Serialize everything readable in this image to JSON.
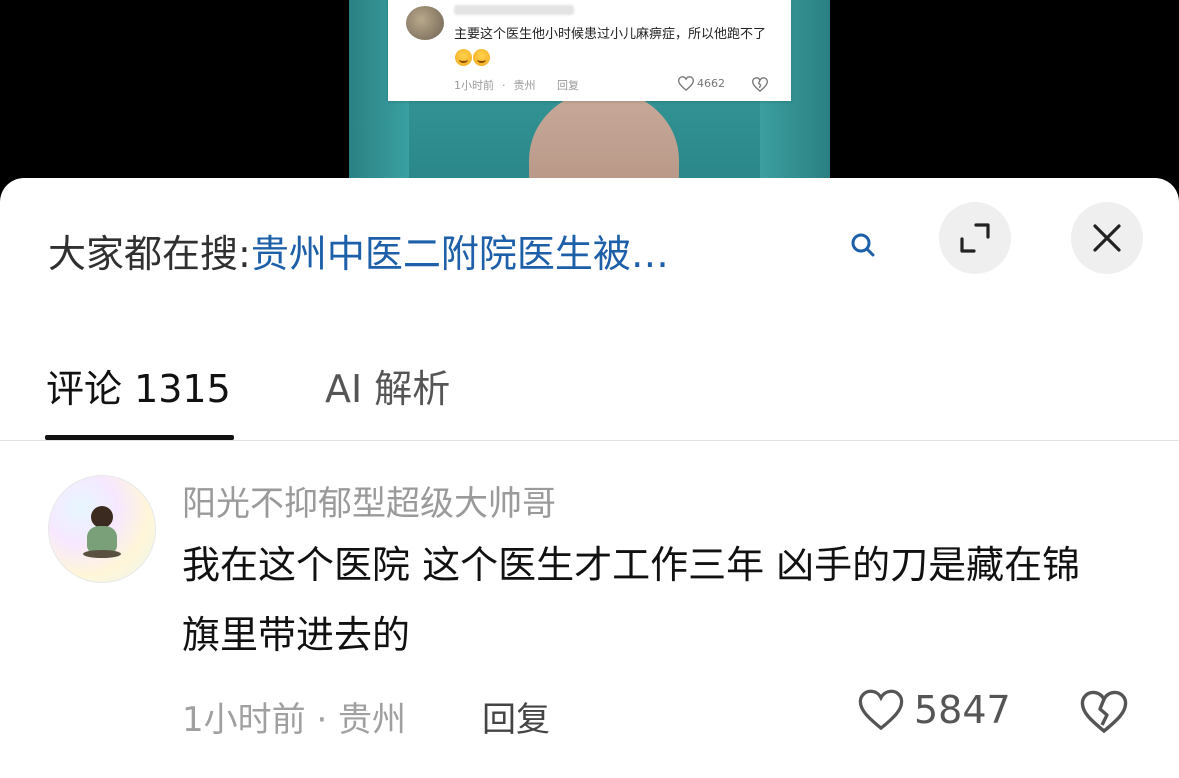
{
  "video_comment": {
    "text": "主要这个医生他小时候患过小儿麻痹症，所以他跑不了",
    "time": "1小时前",
    "location": "贵州",
    "reply_label": "回复",
    "likes": "4662"
  },
  "search_bar": {
    "prefix": "大家都在搜:",
    "query": "贵州中医二附院医生被…"
  },
  "tabs": [
    {
      "label": "评论 1315",
      "active": true
    },
    {
      "label": "AI 解析",
      "active": false
    }
  ],
  "comment": {
    "username": "阳光不抑郁型超级大帅哥",
    "body": "我在这个医院  这个医生才工作三年  凶手的刀是藏在锦旗里带进去的",
    "meta": "1小时前 · 贵州",
    "reply_label": "回复",
    "likes": "5847"
  },
  "colors": {
    "link_blue": "#1d5fa8",
    "sheet_bg": "#ffffff",
    "button_bg": "#efefef"
  },
  "icons": [
    "search-icon",
    "expand-icon",
    "close-icon",
    "heart-icon",
    "broken-heart-icon"
  ]
}
